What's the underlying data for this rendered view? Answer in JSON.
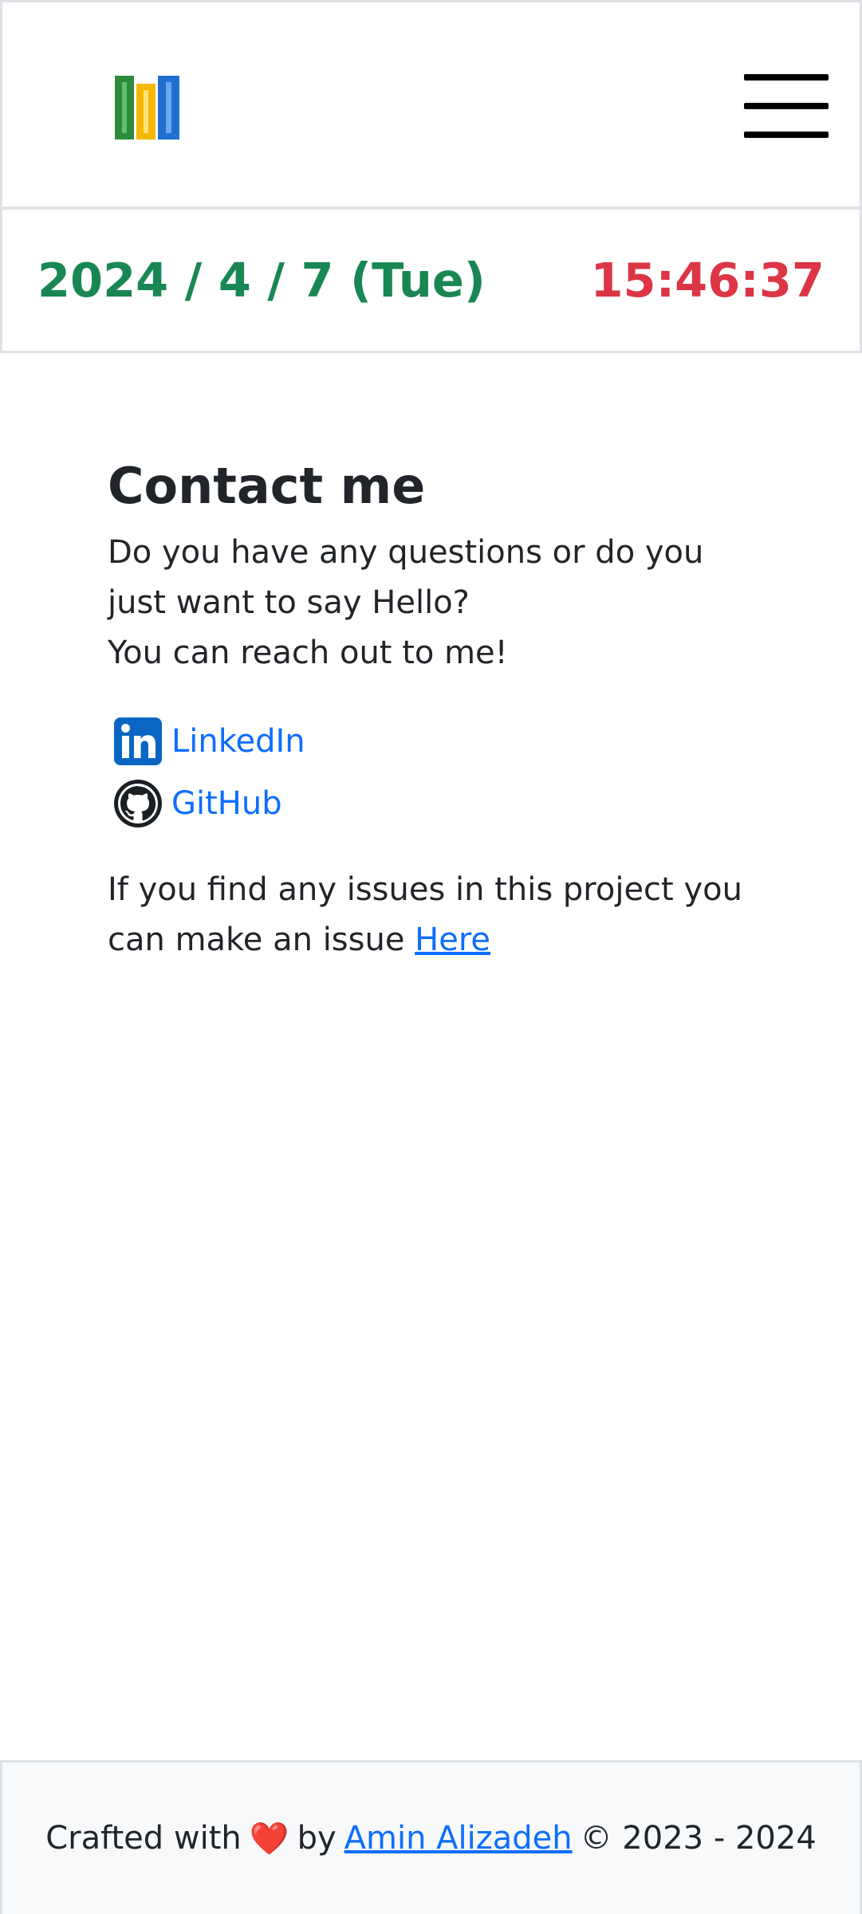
{
  "header": {
    "logo_icon": "books-logo-icon",
    "menu_icon": "hamburger-menu-icon"
  },
  "datebar": {
    "date": "2024 / 4 / 7 (Tue)",
    "time": "15:46:37",
    "date_color": "#198754",
    "time_color": "#dc3545"
  },
  "contact": {
    "title": "Contact me",
    "intro_line1": "Do you have any questions or do you just want to say Hello?",
    "intro_line2": "You can reach out to me!",
    "links": [
      {
        "label": "LinkedIn",
        "icon": "linkedin-icon"
      },
      {
        "label": "GitHub",
        "icon": "github-icon"
      }
    ],
    "issues_text": "If you find any issues in this project you can make an issue",
    "issues_link": "Here"
  },
  "footer": {
    "crafted": "Crafted with",
    "heart": "❤️",
    "by": "by",
    "author": "Amin Alizadeh",
    "copyright": "© 2023 - 2024"
  },
  "colors": {
    "link": "#0d6efd",
    "border": "#dee2e6",
    "footer_bg": "#f8f9fa"
  }
}
